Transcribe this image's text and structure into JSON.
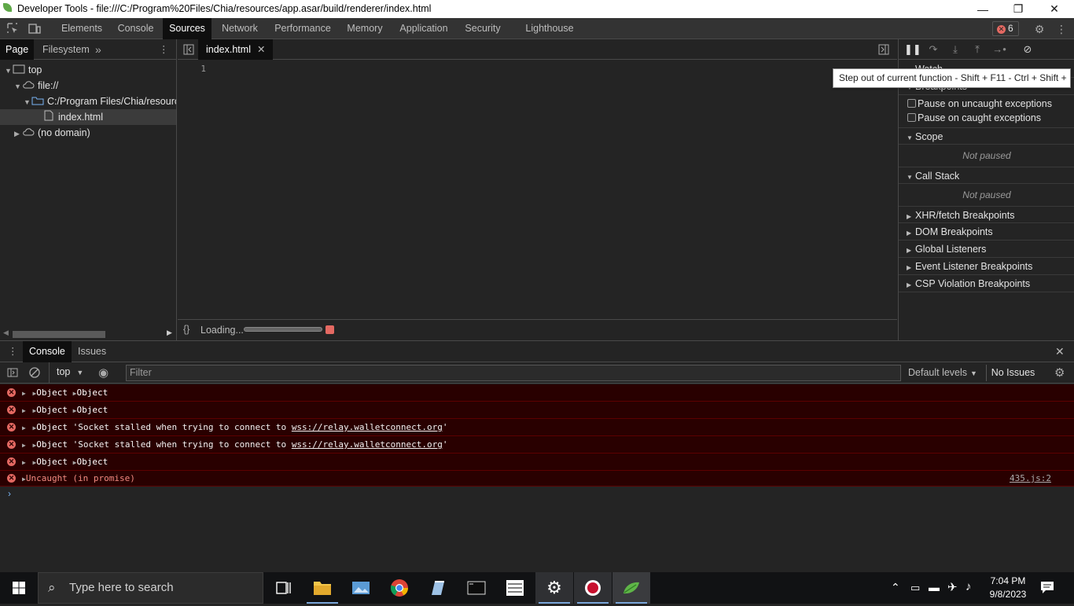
{
  "window": {
    "title": "Developer Tools - file:///C:/Program%20Files/Chia/resources/app.asar/build/renderer/index.html",
    "minimize": "—",
    "maximize": "❐",
    "close": "✕"
  },
  "main_tabs": [
    "Elements",
    "Console",
    "Sources",
    "Network",
    "Performance",
    "Memory",
    "Application",
    "Security",
    "Lighthouse"
  ],
  "active_tab": "Sources",
  "error_count": "6",
  "navigator": {
    "tabs": [
      "Page",
      "Filesystem"
    ],
    "more": "»",
    "tree": [
      {
        "label": "top",
        "depth": 0,
        "icon": "frame-icon",
        "expanded": true
      },
      {
        "label": "file://",
        "depth": 1,
        "icon": "cloud-icon",
        "expanded": true
      },
      {
        "label": "C:/Program Files/Chia/resources/app.asar/build/renderer",
        "depth": 2,
        "icon": "folder-icon",
        "expanded": true
      },
      {
        "label": "index.html",
        "depth": 3,
        "icon": "file-icon",
        "selected": true
      },
      {
        "label": "(no domain)",
        "depth": 1,
        "icon": "cloud-icon",
        "expanded": false
      }
    ]
  },
  "editor": {
    "tab_label": "index.html",
    "line_number": "1",
    "status_text": "Loading..."
  },
  "debugger": {
    "tooltip": "Step out of current function - Shift + F11 - Ctrl + Shift + ;",
    "watch": "Watch",
    "breakpoints": "Breakpoints",
    "pause_uncaught": "Pause on uncaught exceptions",
    "pause_caught": "Pause on caught exceptions",
    "scope": "Scope",
    "not_paused": "Not paused",
    "call_stack": "Call Stack",
    "sections": [
      "XHR/fetch Breakpoints",
      "DOM Breakpoints",
      "Global Listeners",
      "Event Listener Breakpoints",
      "CSP Violation Breakpoints"
    ]
  },
  "drawer": {
    "tabs": [
      "Console",
      "Issues"
    ],
    "context": "top",
    "filter_placeholder": "Filter",
    "levels": "Default levels",
    "no_issues": "No Issues"
  },
  "console_messages": [
    {
      "kind": "object",
      "a": "Object",
      "b": "Object"
    },
    {
      "kind": "object",
      "a": "Object",
      "b": "Object"
    },
    {
      "kind": "socket",
      "a": "Object",
      "pre": "'Socket stalled when trying to connect to ",
      "url": "wss://relay.walletconnect.org",
      "post": "'"
    },
    {
      "kind": "socket",
      "a": "Object",
      "pre": "'Socket stalled when trying to connect to ",
      "url": "wss://relay.walletconnect.org",
      "post": "'"
    },
    {
      "kind": "object",
      "a": "Object",
      "b": "Object"
    },
    {
      "kind": "uncaught",
      "text": "Uncaught (in promise)",
      "source": "435.js:2"
    }
  ],
  "taskbar": {
    "search_placeholder": "Type here to search",
    "time": "7:04 PM",
    "date": "9/8/2023"
  }
}
